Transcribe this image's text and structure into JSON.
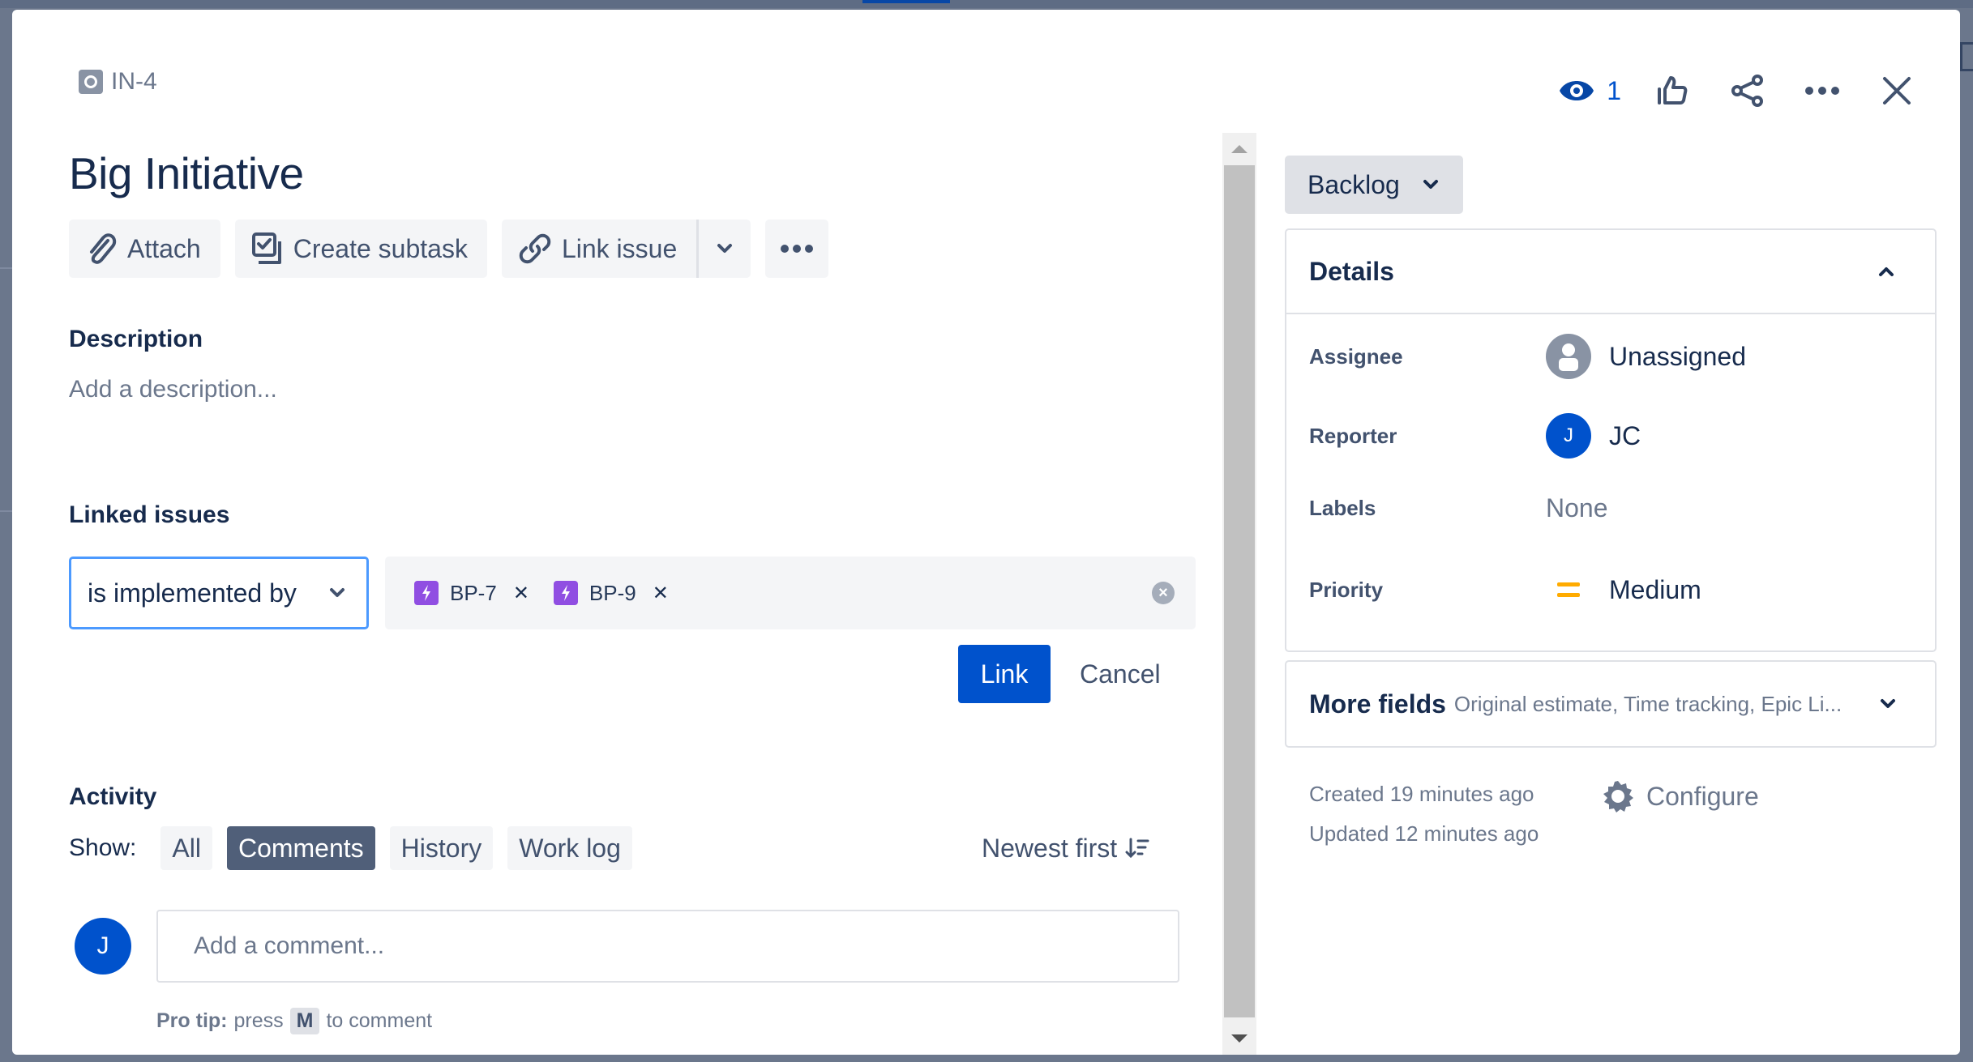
{
  "issue": {
    "key": "IN-4",
    "type_icon": "initiative-icon",
    "title": "Big Initiative"
  },
  "header_actions": {
    "watch_count": "1",
    "icons": [
      "eye-icon",
      "thumbs-up-icon",
      "share-icon",
      "more-icon",
      "close-icon"
    ]
  },
  "action_bar": {
    "attach": "Attach",
    "create_subtask": "Create subtask",
    "link_issue": "Link issue"
  },
  "description": {
    "label": "Description",
    "placeholder": "Add a description..."
  },
  "linked_issues": {
    "label": "Linked issues",
    "link_type": "is implemented by",
    "selected": [
      {
        "key": "BP-7",
        "type": "story",
        "color": "#904ee2"
      },
      {
        "key": "BP-9",
        "type": "story",
        "color": "#904ee2"
      }
    ],
    "link_button": "Link",
    "cancel_button": "Cancel"
  },
  "activity": {
    "label": "Activity",
    "show_label": "Show:",
    "filters": [
      {
        "label": "All",
        "active": false
      },
      {
        "label": "Comments",
        "active": true
      },
      {
        "label": "History",
        "active": false
      },
      {
        "label": "Work log",
        "active": false
      }
    ],
    "sort_label": "Newest first",
    "comment_avatar_initial": "J",
    "comment_placeholder": "Add a comment...",
    "protip_bold": "Pro tip:",
    "protip_press": "press",
    "protip_key": "M",
    "protip_rest": "to comment"
  },
  "sidebar": {
    "status": "Backlog",
    "details": {
      "title": "Details",
      "fields": [
        {
          "label": "Assignee",
          "value": "Unassigned"
        },
        {
          "label": "Reporter",
          "value": "JC",
          "avatar_initial": "J"
        },
        {
          "label": "Labels",
          "value": "None"
        },
        {
          "label": "Priority",
          "value": "Medium",
          "color": "#ffab00"
        }
      ]
    },
    "more_fields": {
      "title": "More fields",
      "subtitle": "Original estimate, Time tracking, Epic Li..."
    },
    "created": "Created 19 minutes ago",
    "updated": "Updated 12 minutes ago",
    "configure": "Configure"
  },
  "colors": {
    "brand": "#0052cc",
    "text": "#172b4d",
    "muted": "#6b778c",
    "story": "#904ee2",
    "priority_medium": "#ffab00"
  }
}
